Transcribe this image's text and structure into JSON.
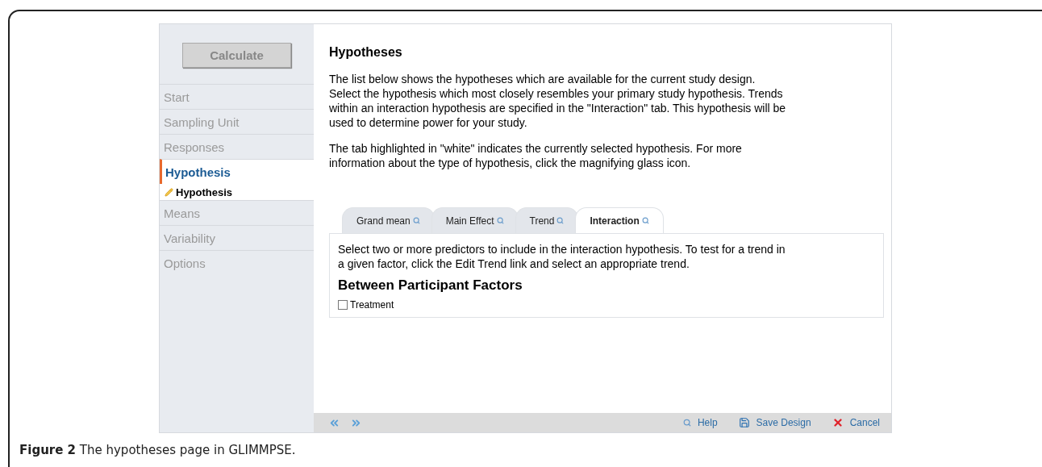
{
  "sidebar": {
    "calculate_button": "Calculate",
    "items": [
      {
        "label": "Start",
        "selected": false
      },
      {
        "label": "Sampling Unit",
        "selected": false
      },
      {
        "label": "Responses",
        "selected": false
      },
      {
        "label": "Hypothesis",
        "selected": true,
        "children": [
          {
            "label": "Hypothesis"
          }
        ]
      },
      {
        "label": "Means",
        "selected": false
      },
      {
        "label": "Variability",
        "selected": false
      },
      {
        "label": "Options",
        "selected": false
      }
    ]
  },
  "main": {
    "title": "Hypotheses",
    "paragraphs": [
      "The list below shows the hypotheses which are available for the current study design. Select the hypothesis which most closely resembles your primary study hypothesis. Trends within an interaction hypothesis are specified in the \"Interaction\" tab. This hypothesis will be used to determine power for your study.",
      "The tab highlighted in \"white\" indicates the currently selected hypothesis. For more information about the type of hypothesis, click the magnifying glass icon."
    ],
    "tabs": [
      {
        "label": "Grand mean",
        "selected": false
      },
      {
        "label": "Main Effect",
        "selected": false
      },
      {
        "label": "Trend",
        "selected": false
      },
      {
        "label": "Interaction",
        "selected": true
      }
    ],
    "panel": {
      "instructions": "Select two or more predictors to include in the interaction hypothesis. To test for a trend in a given factor, click the Edit Trend link and select an appropriate trend.",
      "heading": "Between Participant Factors",
      "factors": [
        {
          "label": "Treatment",
          "checked": false
        }
      ]
    }
  },
  "footer": {
    "actions": [
      {
        "kind": "help",
        "label": "Help"
      },
      {
        "kind": "save",
        "label": "Save Design"
      },
      {
        "kind": "cancel",
        "label": "Cancel"
      }
    ]
  },
  "caption": "**Figure 2** The hypotheses page in GLIMMPSE."
}
